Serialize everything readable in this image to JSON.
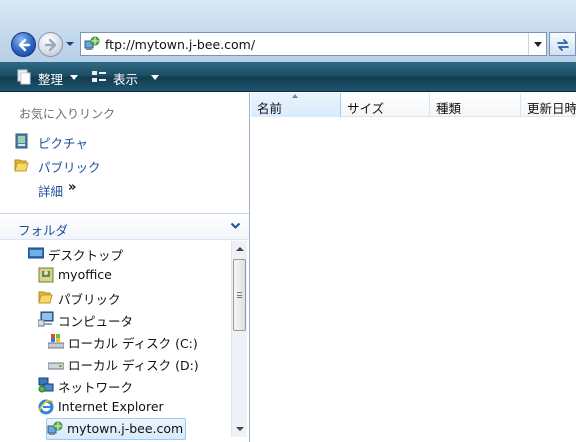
{
  "address_bar": {
    "url": "ftp://mytown.j-bee.com/",
    "icons": {
      "back": "back-arrow-icon",
      "forward": "forward-arrow-icon",
      "history": "chevron-down-icon",
      "site": "ftp-site-icon",
      "refresh": "refresh-icon"
    }
  },
  "command_bar": {
    "organize_label": "整理",
    "views_label": "表示"
  },
  "favorites": {
    "header": "お気に入りリンク",
    "items": [
      {
        "label": "ピクチャ",
        "icon": "pictures-icon"
      },
      {
        "label": "パブリック",
        "icon": "public-folder-icon"
      }
    ],
    "more_label": "詳細",
    "more_arrows": "»"
  },
  "folders": {
    "header": "フォルダ",
    "tree": [
      {
        "label": "デスクトップ",
        "icon": "desktop-icon"
      },
      {
        "label": "myoffice",
        "icon": "user-folder-icon"
      },
      {
        "label": "パブリック",
        "icon": "public-folder-icon"
      },
      {
        "label": "コンピュータ",
        "icon": "computer-icon"
      },
      {
        "label": "ローカル ディスク (C:)",
        "icon": "system-drive-icon"
      },
      {
        "label": "ローカル ディスク (D:)",
        "icon": "drive-icon"
      },
      {
        "label": "ネットワーク",
        "icon": "network-icon"
      },
      {
        "label": "Internet Explorer",
        "icon": "internet-explorer-icon"
      },
      {
        "label": "mytown.j-bee.com",
        "icon": "ftp-site-icon",
        "selected": true
      }
    ]
  },
  "file_list": {
    "columns": [
      "名前",
      "サイズ",
      "種類",
      "更新日時"
    ],
    "sorted_by": "名前"
  },
  "colors": {
    "command_bar": "#1d4c63",
    "link_blue": "#1c4e9a",
    "selection": "#d8eafb"
  }
}
